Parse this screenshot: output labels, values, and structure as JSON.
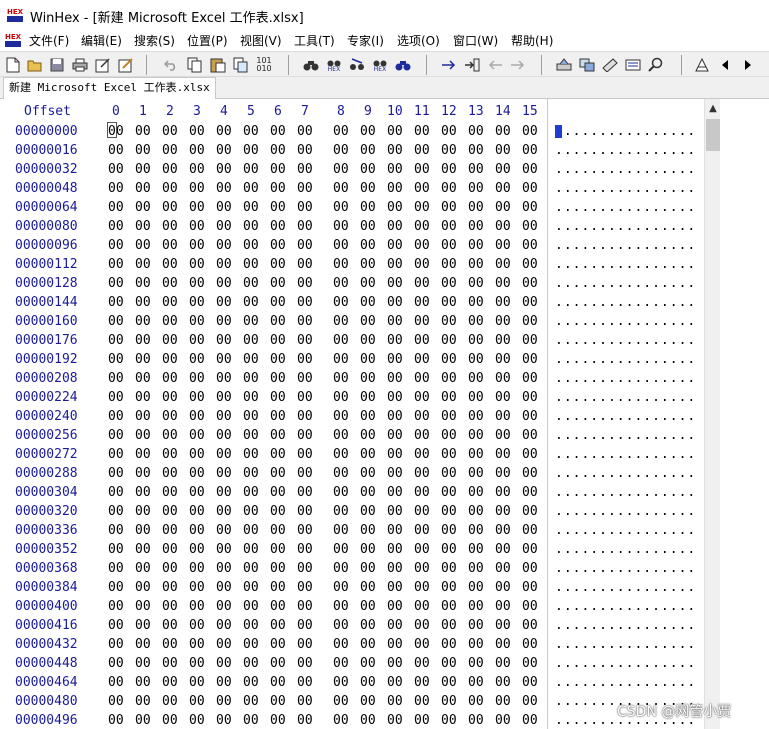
{
  "window": {
    "title": "WinHex - [新建 Microsoft Excel 工作表.xlsx]"
  },
  "menu": [
    "文件(F)",
    "编辑(E)",
    "搜索(S)",
    "位置(P)",
    "视图(V)",
    "工具(T)",
    "专家(I)",
    "选项(O)",
    "窗口(W)",
    "帮助(H)"
  ],
  "toolbar": {
    "icons": [
      "new-file-icon",
      "open-folder-icon",
      "save-icon",
      "print-icon",
      "properties-icon",
      "edit-icon",
      "undo-icon",
      "copy-icon",
      "paste-icon",
      "clipboard-icon",
      "binary-icon",
      "find-text-icon",
      "find-hex-icon",
      "replace-text-icon",
      "replace-hex-icon",
      "find-next-icon",
      "goto-offset-icon",
      "goto-icon",
      "back-icon",
      "forward-icon",
      "disk-icon",
      "ram-icon",
      "calculator-icon",
      "ruler-icon",
      "search-icon",
      "scan-icon",
      "prev-icon",
      "next-icon"
    ],
    "binary_label": "101\n010",
    "hex_label": "HEX"
  },
  "tab": {
    "label": "新建 Microsoft Excel 工作表.xlsx"
  },
  "hex_view": {
    "offset_header": "Offset",
    "columns": [
      "0",
      "1",
      "2",
      "3",
      "4",
      "5",
      "6",
      "7",
      "8",
      "9",
      "10",
      "11",
      "12",
      "13",
      "14",
      "15"
    ],
    "offsets": [
      "00000000",
      "00000016",
      "00000032",
      "00000048",
      "00000064",
      "00000080",
      "00000096",
      "00000112",
      "00000128",
      "00000144",
      "00000160",
      "00000176",
      "00000192",
      "00000208",
      "00000224",
      "00000240",
      "00000256",
      "00000272",
      "00000288",
      "00000304",
      "00000320",
      "00000336",
      "00000352",
      "00000368",
      "00000384",
      "00000400",
      "00000416",
      "00000432",
      "00000448",
      "00000464",
      "00000480",
      "00000496"
    ],
    "byte_value": "00",
    "ascii_row": "................",
    "cursor_offset": "00000000"
  },
  "watermark": "CSDN @网管小贾",
  "colors": {
    "offset_text": "#1a1a9a",
    "cursor": "#1c3fcf",
    "toolbar_bg": "#f0f0f0"
  }
}
